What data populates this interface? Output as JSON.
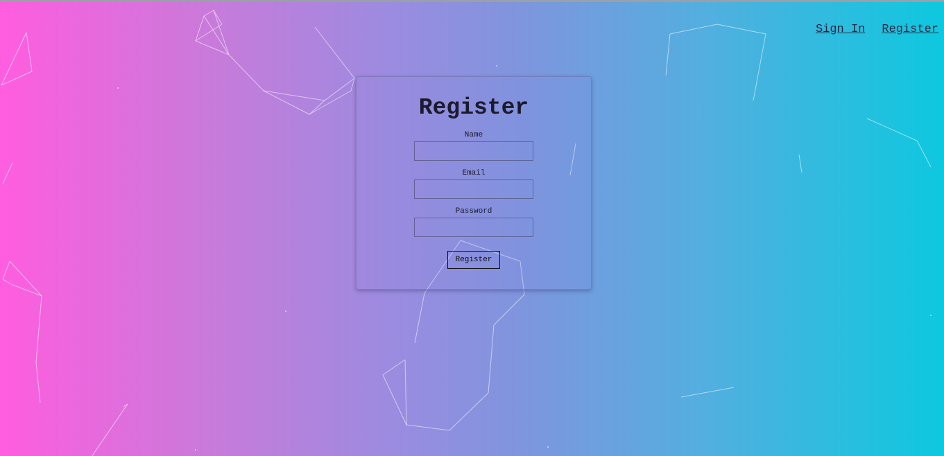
{
  "nav": {
    "sign_in_label": "Sign In",
    "register_label": "Register"
  },
  "form": {
    "title": "Register",
    "name_label": "Name",
    "name_value": "",
    "email_label": "Email",
    "email_value": "",
    "password_label": "Password",
    "password_value": "",
    "submit_label": "Register"
  },
  "colors": {
    "gradient_left": "#ff5ddf",
    "gradient_mid": "#9a8ce0",
    "gradient_right": "#0dc8df",
    "text_dark": "#1c1a2c"
  }
}
